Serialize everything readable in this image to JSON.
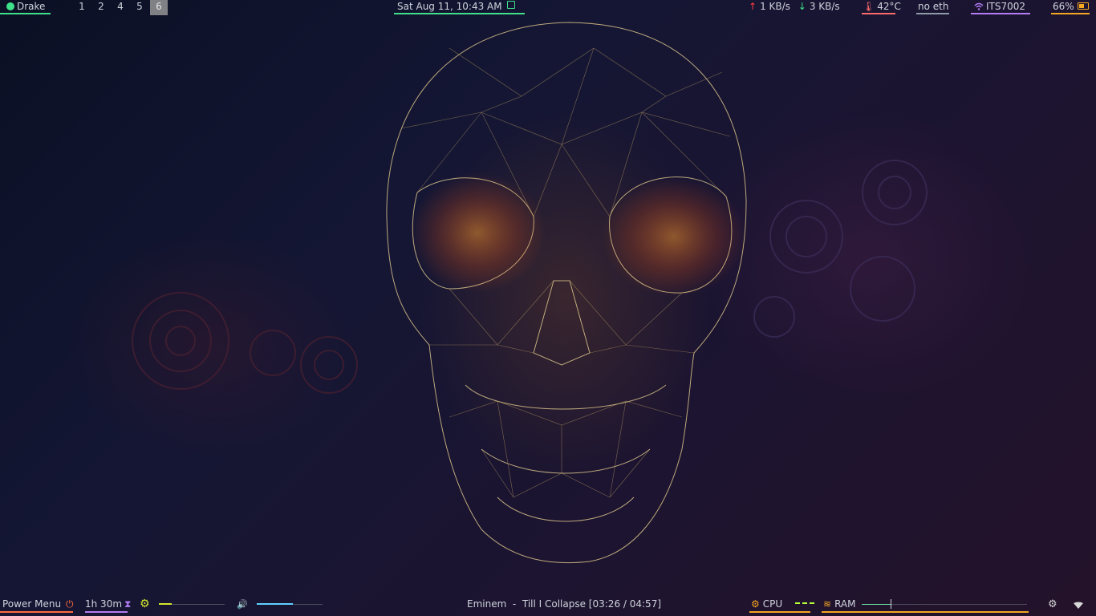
{
  "colors": {
    "green": "#3ee08a",
    "red": "#ff6b6b",
    "slate": "#8f9aa8",
    "purple": "#b27cf2",
    "orange": "#f5a623",
    "power": "#ff6b3d",
    "yellow": "#d4e82a",
    "cyan": "#5fd0ff"
  },
  "top_bar": {
    "user": {
      "name": "Drake",
      "icon": "user-icon"
    },
    "workspaces": [
      {
        "label": "1",
        "active": false
      },
      {
        "label": "2",
        "active": false
      },
      {
        "label": "4",
        "active": false
      },
      {
        "label": "5",
        "active": false
      },
      {
        "label": "6",
        "active": true
      }
    ],
    "clock": {
      "text": "Sat Aug 11, 10:43 AM",
      "icon": "calendar-icon"
    },
    "net_speed": {
      "up": "1 KB/s",
      "down": "3 KB/s",
      "up_icon": "arrow-up-icon",
      "down_icon": "arrow-down-icon"
    },
    "temperature": {
      "text": "42°C",
      "icon": "thermometer-icon"
    },
    "ethernet": {
      "text": "no eth"
    },
    "wifi": {
      "text": "ITS7002",
      "icon": "wifi-icon"
    },
    "battery": {
      "text": "66%",
      "icon": "battery-icon",
      "level": 0.66
    }
  },
  "bottom_bar": {
    "power_menu": {
      "label": "Power Menu",
      "icon": "power-icon"
    },
    "timer": {
      "text": "1h 30m",
      "icon": "hourglass-icon"
    },
    "brightness": {
      "icon": "brightness-icon",
      "level": 0.2
    },
    "volume": {
      "icon": "speaker-icon",
      "level": 0.55
    },
    "now_playing": {
      "text": "Eminem  -  Till I Collapse [03:26 / 04:57]"
    },
    "cpu": {
      "label": "CPU",
      "icon": "cpu-icon"
    },
    "ram": {
      "label": "RAM",
      "icon": "database-icon"
    },
    "tray": [
      {
        "icon": "settings-gear-icon"
      },
      {
        "icon": "wifi-tray-icon"
      }
    ]
  }
}
